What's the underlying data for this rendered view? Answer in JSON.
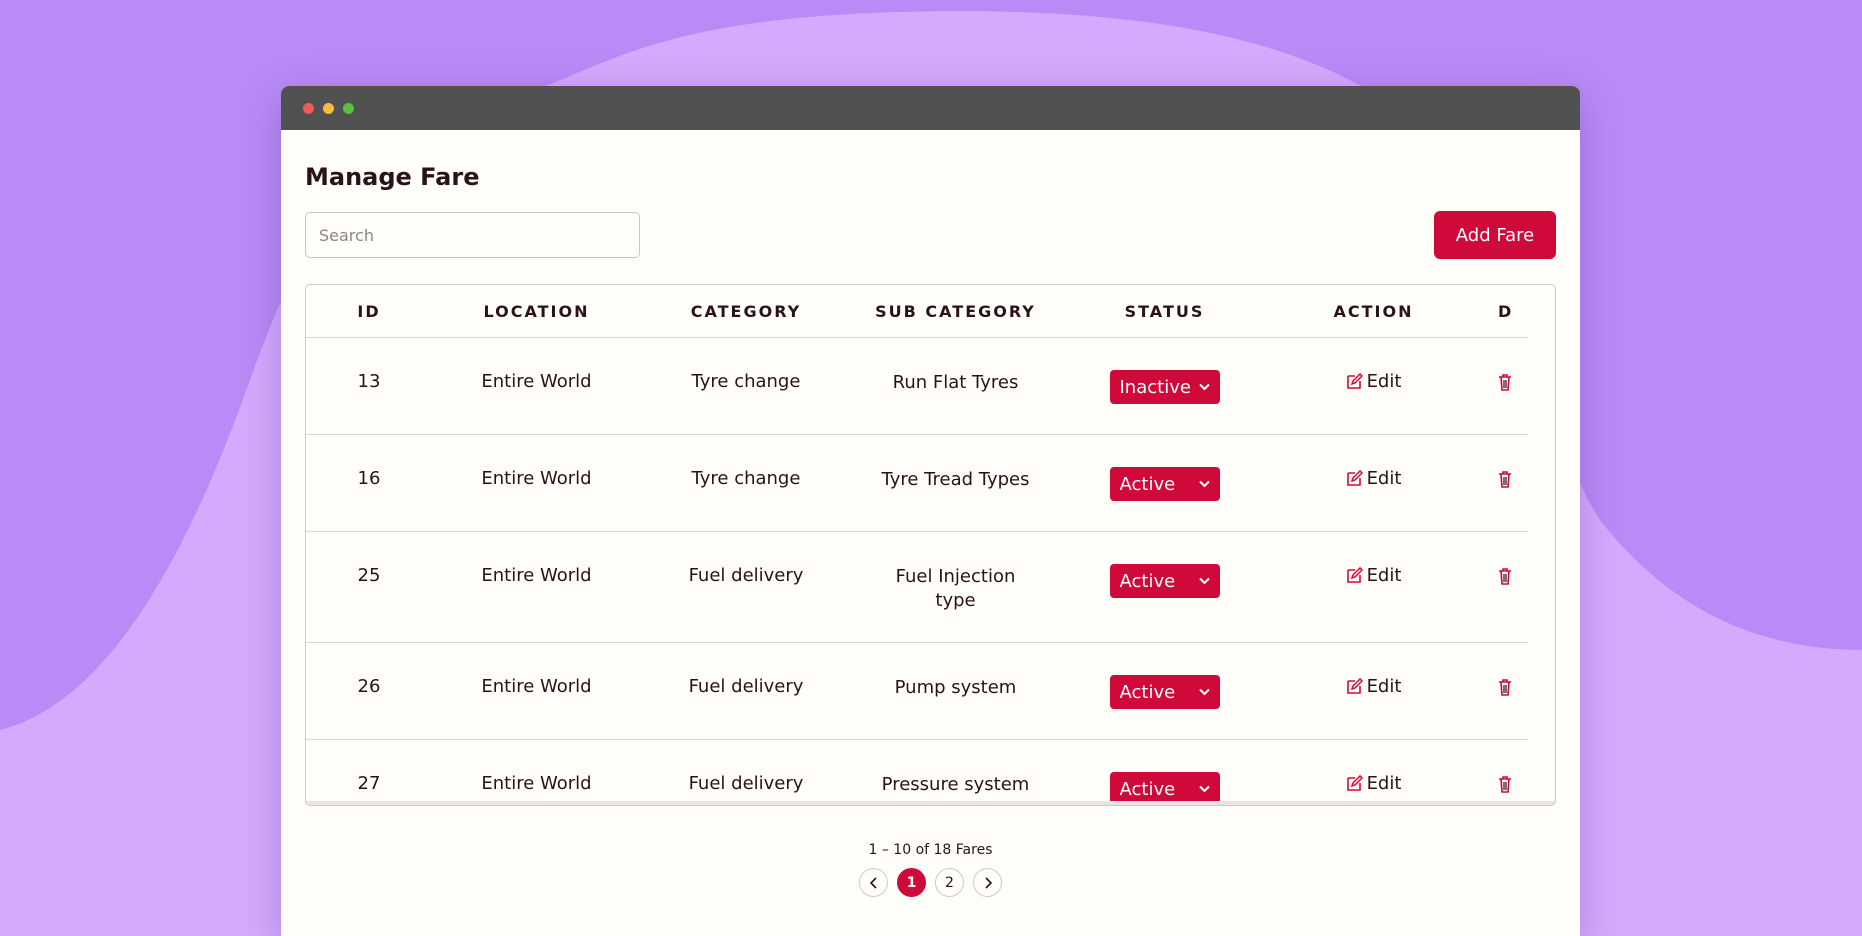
{
  "colors": {
    "background": "#b98bf6",
    "blob": "#d3aafd",
    "accent": "#d0093b",
    "titlebar": "#515151",
    "panel": "#fffef9"
  },
  "page": {
    "title": "Manage Fare"
  },
  "search": {
    "placeholder": "Search",
    "value": ""
  },
  "toolbar": {
    "add_label": "Add Fare"
  },
  "table": {
    "headers": {
      "id": "ID",
      "location": "LOCATION",
      "category": "CATEGORY",
      "sub_category": "SUB CATEGORY",
      "status": "STATUS",
      "action": "ACTION",
      "delete": "D"
    },
    "rows": [
      {
        "id": "13",
        "location": "Entire World",
        "category": "Tyre change",
        "sub_category": "Run Flat Tyres",
        "status": "Inactive",
        "action": "Edit"
      },
      {
        "id": "16",
        "location": "Entire World",
        "category": "Tyre change",
        "sub_category": "Tyre Tread Types",
        "status": "Active",
        "action": "Edit"
      },
      {
        "id": "25",
        "location": "Entire World",
        "category": "Fuel delivery",
        "sub_category": "Fuel Injection type",
        "status": "Active",
        "action": "Edit"
      },
      {
        "id": "26",
        "location": "Entire World",
        "category": "Fuel delivery",
        "sub_category": "Pump system",
        "status": "Active",
        "action": "Edit"
      },
      {
        "id": "27",
        "location": "Entire World",
        "category": "Fuel delivery",
        "sub_category": "Pressure system",
        "status": "Active",
        "action": "Edit"
      }
    ]
  },
  "pagination": {
    "summary": "1 – 10 of 18 Fares",
    "pages": [
      "1",
      "2"
    ],
    "current_page": "1"
  },
  "icons": {
    "edit": "edit-icon",
    "delete": "trash-icon",
    "prev": "chevron-left-icon",
    "next": "chevron-right-icon",
    "dropdown": "chevron-down-icon"
  }
}
